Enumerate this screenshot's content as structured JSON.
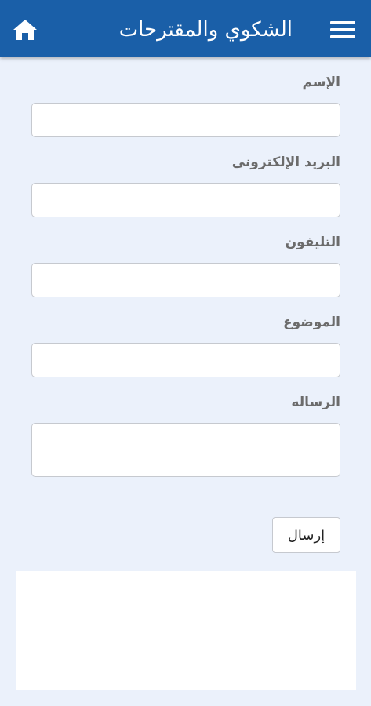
{
  "header": {
    "title": "الشكوي والمقترحات",
    "home_icon": "home-icon",
    "menu_icon": "hamburger-menu-icon",
    "bar_color": "#1a5fa8"
  },
  "form": {
    "name_label": "الإسم",
    "email_label": "البريد الإلكترونى",
    "phone_label": "التليفون",
    "subject_label": "الموضوع",
    "message_label": "الرساله",
    "name_value": "",
    "email_value": "",
    "phone_value": "",
    "subject_value": "",
    "message_value": "",
    "send_label": "إرسال"
  }
}
